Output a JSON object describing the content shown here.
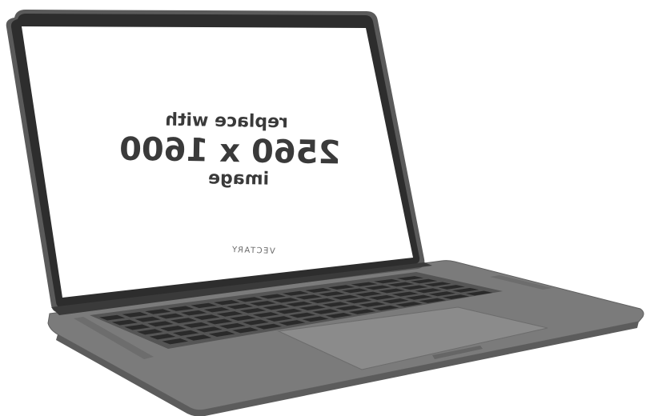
{
  "screen": {
    "line1": "replace with",
    "line2": "2560 x 1600",
    "line3": "image",
    "brand": "VECTARY",
    "mirrored": true
  },
  "colors": {
    "background": "#ffffff",
    "lid_bezel": "#2f2f2f",
    "lid_edge": "#5a5a5a",
    "screen": "#ffffff",
    "base_body": "#7b7b7b",
    "base_edge": "#5e5e5e",
    "keyboard_well": "#4a4a4a",
    "key": "#2b2b2b",
    "trackpad": "#8a8a8a"
  }
}
